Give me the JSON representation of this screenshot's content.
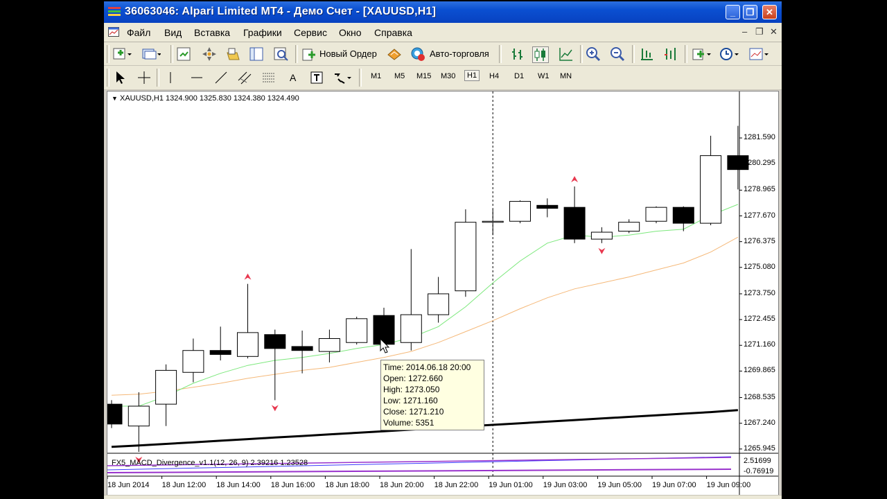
{
  "window": {
    "title": "36063046: Alpari Limited MT4 - Демо Счет - [XAUUSD,H1]",
    "minimize_glyph": "_",
    "maximize_glyph": "❐",
    "close_glyph": "✕"
  },
  "menu": {
    "items": [
      "Файл",
      "Вид",
      "Вставка",
      "Графики",
      "Сервис",
      "Окно",
      "Справка"
    ],
    "mdi_minimize": "–",
    "mdi_restore": "❐",
    "mdi_close": "✕"
  },
  "toolbar1": {
    "new_order_label": "Новый Ордер",
    "auto_trading_label": "Авто-торговля"
  },
  "toolbar2": {
    "text_tool_label": "A",
    "timeframes": [
      "M1",
      "M5",
      "M15",
      "M30",
      "H1",
      "H4",
      "D1",
      "W1",
      "MN"
    ],
    "active_timeframe": "H1"
  },
  "chart": {
    "header": "XAUUSD,H1  1324.900 1325.830 1324.380 1324.490",
    "indicator_header": "FX5_MACD_Divergence_v1.1(12, 26, 9) 2.39216 1.23528",
    "indicator_scale": [
      "2.51699",
      "-0.76919"
    ],
    "tooltip": {
      "time": "Time: 2014.06.18 20:00",
      "open": "Open: 1272.660",
      "high": "High: 1273.050",
      "low": "Low:  1271.160",
      "close": "Close: 1271.210",
      "volume": "Volume: 5351"
    },
    "colors": {
      "bull": "#ffffff",
      "bear": "#000000",
      "ma_fast": "#7ce87c",
      "ma_slow": "#f5b878",
      "ma_long": "#000000",
      "arrows": "#e8384f",
      "macd_main": "#9932cc",
      "macd_signal": "#3a3aff",
      "tooltip_bg": "#ffffe1"
    }
  },
  "chart_data": {
    "type": "candlestick",
    "symbol": "XAUUSD",
    "timeframe": "H1",
    "y_ticks": [
      1281.59,
      1280.295,
      1278.965,
      1277.67,
      1276.375,
      1275.08,
      1273.75,
      1272.455,
      1271.16,
      1269.865,
      1268.535,
      1267.24,
      1265.945
    ],
    "y_tick_labels": [
      "1281.590",
      "1280.295",
      "1278.965",
      "1277.670",
      "1276.375",
      "1275.080",
      "1273.750",
      "1272.455",
      "1271.160",
      "1269.865",
      "1268.535",
      "1267.240",
      "1265.945"
    ],
    "ylim": [
      1265.8,
      1283.3
    ],
    "x_labels": [
      "18 Jun 2014",
      "18 Jun 12:00",
      "18 Jun 14:00",
      "18 Jun 16:00",
      "18 Jun 18:00",
      "18 Jun 20:00",
      "18 Jun 22:00",
      "19 Jun 01:00",
      "19 Jun 03:00",
      "19 Jun 05:00",
      "19 Jun 07:00",
      "19 Jun 09:00"
    ],
    "candles": [
      {
        "o": 1268.2,
        "h": 1268.4,
        "l": 1267.0,
        "c": 1267.2
      },
      {
        "o": 1267.1,
        "h": 1268.8,
        "l": 1265.8,
        "c": 1268.1
      },
      {
        "o": 1268.2,
        "h": 1270.2,
        "l": 1267.1,
        "c": 1269.9
      },
      {
        "o": 1269.8,
        "h": 1271.5,
        "l": 1269.3,
        "c": 1270.9
      },
      {
        "o": 1270.9,
        "h": 1272.1,
        "l": 1270.4,
        "c": 1270.7
      },
      {
        "o": 1270.6,
        "h": 1274.25,
        "l": 1270.5,
        "c": 1271.8
      },
      {
        "o": 1271.7,
        "h": 1271.95,
        "l": 1268.4,
        "c": 1271.0
      },
      {
        "o": 1271.1,
        "h": 1271.9,
        "l": 1269.75,
        "c": 1270.9
      },
      {
        "o": 1270.85,
        "h": 1271.95,
        "l": 1270.3,
        "c": 1271.5
      },
      {
        "o": 1271.3,
        "h": 1272.6,
        "l": 1271.2,
        "c": 1272.5
      },
      {
        "o": 1272.66,
        "h": 1273.05,
        "l": 1271.16,
        "c": 1271.21
      },
      {
        "o": 1271.3,
        "h": 1276.0,
        "l": 1270.9,
        "c": 1272.7
      },
      {
        "o": 1272.7,
        "h": 1274.6,
        "l": 1272.3,
        "c": 1273.75
      },
      {
        "o": 1273.9,
        "h": 1278.0,
        "l": 1273.6,
        "c": 1277.35
      },
      {
        "o": 1277.4,
        "h": 1278.0,
        "l": 1276.7,
        "c": 1277.4
      },
      {
        "o": 1277.4,
        "h": 1278.45,
        "l": 1277.3,
        "c": 1278.4
      },
      {
        "o": 1278.2,
        "h": 1278.55,
        "l": 1277.6,
        "c": 1278.05
      },
      {
        "o": 1278.1,
        "h": 1279.15,
        "l": 1276.3,
        "c": 1276.5
      },
      {
        "o": 1276.5,
        "h": 1277.1,
        "l": 1276.3,
        "c": 1276.85
      },
      {
        "o": 1276.9,
        "h": 1277.5,
        "l": 1276.8,
        "c": 1277.35
      },
      {
        "o": 1277.4,
        "h": 1278.15,
        "l": 1277.3,
        "c": 1278.1
      },
      {
        "o": 1278.1,
        "h": 1278.15,
        "l": 1276.9,
        "c": 1277.3
      },
      {
        "o": 1277.3,
        "h": 1281.7,
        "l": 1277.2,
        "c": 1280.7
      },
      {
        "o": 1280.7,
        "h": 1282.2,
        "l": 1279.0,
        "c": 1280.0
      }
    ],
    "ma_fast": [
      1268.1,
      1268.1,
      1268.6,
      1269.25,
      1269.75,
      1270.15,
      1270.4,
      1270.55,
      1270.75,
      1271.0,
      1271.2,
      1271.55,
      1272.1,
      1273.1,
      1274.3,
      1275.4,
      1276.3,
      1276.7,
      1276.6,
      1276.7,
      1276.9,
      1277.0,
      1277.7,
      1278.25
    ],
    "ma_slow": [
      1268.65,
      1268.7,
      1268.85,
      1269.05,
      1269.25,
      1269.5,
      1269.7,
      1269.9,
      1270.05,
      1270.3,
      1270.55,
      1270.85,
      1271.3,
      1271.85,
      1272.4,
      1273.0,
      1273.55,
      1274.0,
      1274.3,
      1274.6,
      1274.95,
      1275.3,
      1275.85,
      1276.6
    ],
    "ma_long": [
      1266.05,
      1266.12,
      1266.2,
      1266.28,
      1266.36,
      1266.44,
      1266.52,
      1266.6,
      1266.68,
      1266.76,
      1266.84,
      1266.92,
      1267.0,
      1267.08,
      1267.16,
      1267.24,
      1267.32,
      1267.4,
      1267.48,
      1267.56,
      1267.64,
      1267.72,
      1267.8,
      1267.9
    ],
    "up_arrows_at": [
      5,
      17
    ],
    "down_arrows_at": [
      1,
      6,
      18
    ],
    "cursor_candle": 14
  }
}
